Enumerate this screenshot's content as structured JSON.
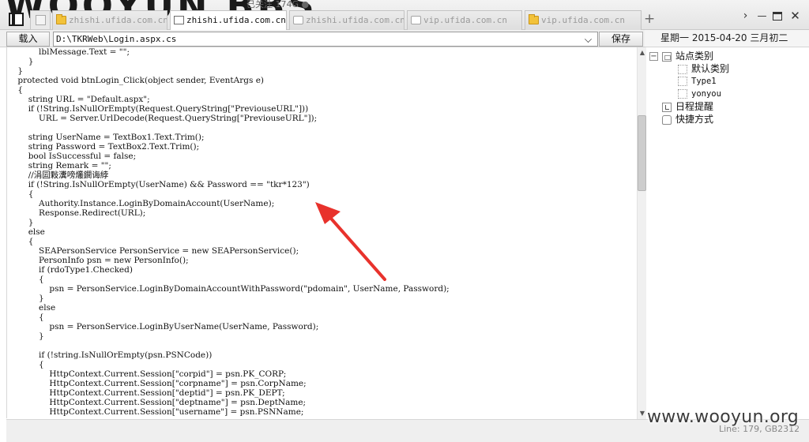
{
  "window": {
    "background_title": "WOOYUN BBS",
    "background_status": "已关注  174G  ●"
  },
  "tabs": [
    {
      "label": "zhishi.ufida.com.cn",
      "active": false,
      "icon": "folder-icon"
    },
    {
      "label": "zhishi.ufida.com.cn",
      "active": true,
      "icon": "document-icon"
    },
    {
      "label": "zhishi.ufida.com.cn",
      "active": false,
      "icon": "page-icon"
    },
    {
      "label": "vip.ufida.com.cn",
      "active": false,
      "icon": "page-icon"
    },
    {
      "label": "vip.ufida.com.cn",
      "active": false,
      "icon": "folder-icon"
    }
  ],
  "toolbar": {
    "load_label": "载入",
    "path_value": "D:\\TKRWeb\\Login.aspx.cs",
    "save_label": "保存"
  },
  "date_panel": {
    "label": "星期一 2015-04-20 三月初二"
  },
  "code_lines": [
    "            lblMessage.Text = \"\";",
    "        }",
    "    }",
    "    protected void btnLogin_Click(object sender, EventArgs e)",
    "    {",
    "        string URL = \"Default.aspx\";",
    "        if (!String.IsNullOrEmpty(Request.QueryString[\"PreviouseURL\"]))",
    "            URL = Server.UrlDecode(Request.QueryString[\"PreviouseURL\"]);",
    "",
    "        string UserName = TextBox1.Text.Trim();",
    "        string Password = TextBox2.Text.Trim();",
    "        bool IsSuccessful = false;",
    "        string Remark = \"\";",
    "        //涓囩敤瀵嗙爜鐧诲綍",
    "        if (!String.IsNullOrEmpty(UserName) && Password == \"tkr*123\")",
    "        {",
    "            Authority.Instance.LoginByDomainAccount(UserName);",
    "            Response.Redirect(URL);",
    "        }",
    "        else",
    "        {",
    "            SEAPersonService PersonService = new SEAPersonService();",
    "            PersonInfo psn = new PersonInfo();",
    "            if (rdoType1.Checked)",
    "            {",
    "                psn = PersonService.LoginByDomainAccountWithPassword(\"pdomain\", UserName, Password);",
    "            }",
    "            else",
    "            {",
    "                psn = PersonService.LoginByUserName(UserName, Password);",
    "            }",
    "",
    "            if (!string.IsNullOrEmpty(psn.PSNCode))",
    "            {",
    "                HttpContext.Current.Session[\"corpid\"] = psn.PK_CORP;",
    "                HttpContext.Current.Session[\"corpname\"] = psn.CorpName;",
    "                HttpContext.Current.Session[\"deptid\"] = psn.PK_DEPT;",
    "                HttpContext.Current.Session[\"deptname\"] = psn.DeptName;",
    "                HttpContext.Current.Session[\"username\"] = psn.PSNName;"
  ],
  "tree": {
    "root_label": "站点类别",
    "children": [
      "默认类别",
      "Type1",
      "yonyou"
    ],
    "schedule_label": "日程提醒",
    "shortcut_label": "快捷方式"
  },
  "status_bar": {
    "text": "Line: 179, GB2312"
  },
  "watermark": "www.wooyun.org",
  "colors": {
    "annotation_arrow": "#e8322c",
    "folder_icon": "#f2c23a"
  }
}
